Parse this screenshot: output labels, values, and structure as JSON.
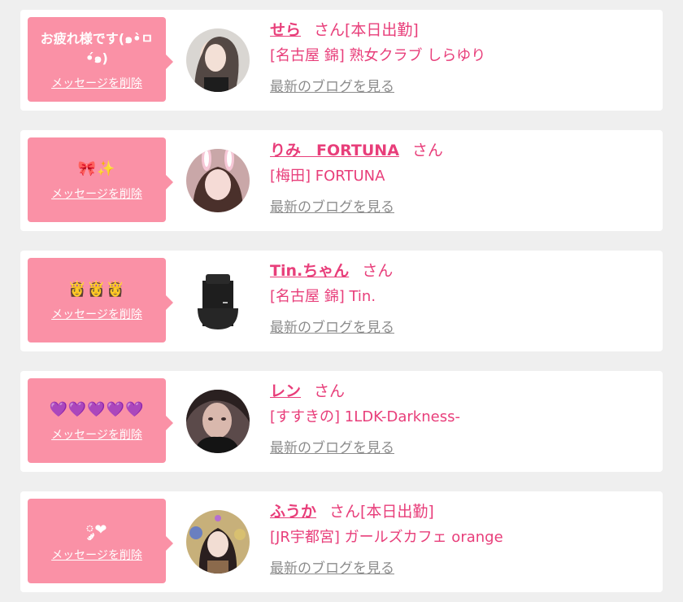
{
  "cards": [
    {
      "message": "お疲れ様です(๑•̀ㅁ•́๑)",
      "delete_label": "メッセージを削除",
      "name": "せら",
      "suffix": "さん[本日出勤]",
      "shop": "[名古屋 錦] 熟女クラブ しらゆり",
      "blog_link": "最新のブログを見る"
    },
    {
      "message": "🎀✨",
      "delete_label": "メッセージを削除",
      "name": "りみ　FORTUNA",
      "suffix": "さん",
      "shop": "[梅田] FORTUNA",
      "blog_link": "最新のブログを見る"
    },
    {
      "message": "👸👸👸",
      "delete_label": "メッセージを削除",
      "name": "Tin.ちゃん",
      "suffix": "さん",
      "shop": "[名古屋 錦] Tin.",
      "blog_link": "最新のブログを見る"
    },
    {
      "message": "💜💜💜💜💜",
      "delete_label": "メッセージを削除",
      "name": "レン",
      "suffix": "さん",
      "shop": "[すすきの] 1LDK-Darkness-",
      "blog_link": "最新のブログを見る"
    },
    {
      "message": "༘❤︎",
      "delete_label": "メッセージを削除",
      "name": "ふうか",
      "suffix": "さん[本日出勤]",
      "shop": "[JR宇都宮] ガールズカフェ orange",
      "blog_link": "最新のブログを見る"
    }
  ],
  "colors": {
    "page_bg": "#efefef",
    "card_bg": "#ffffff",
    "bubble_bg": "#fa91a6",
    "accent_pink": "#e83e7a",
    "link_gray": "#8c8c8c"
  }
}
